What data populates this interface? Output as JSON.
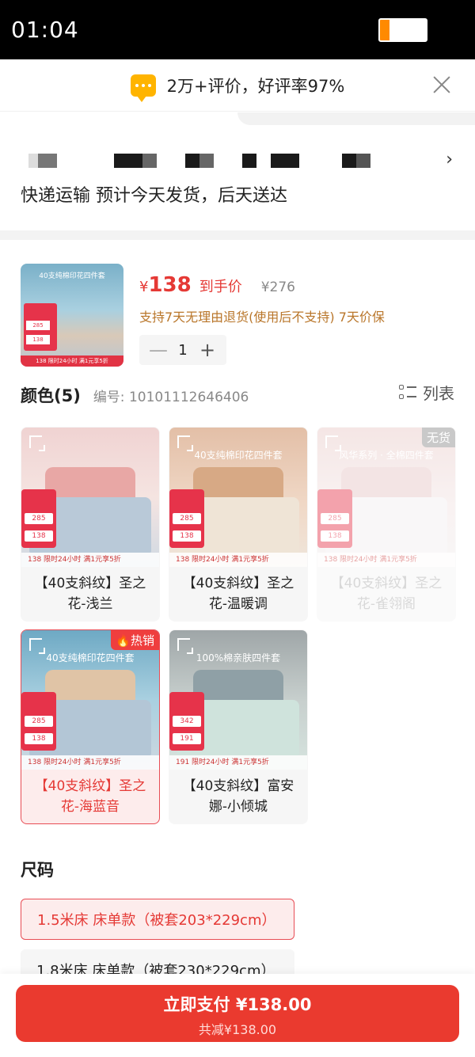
{
  "status_bar": {
    "time": "01:04",
    "battery_level": 0.2
  },
  "rating": {
    "text": "2万+评价，好评率97%"
  },
  "address": {
    "shipping_text": "快递运输 预计今天发货，后天送达",
    "arrow": "›"
  },
  "product": {
    "currency": "¥",
    "price": "138",
    "price_tag": "到手价",
    "original_price": "¥276",
    "policy": "支持7天无理由退货(使用后不支持) 7天价保",
    "quantity": "1",
    "minus": "—",
    "plus": "+",
    "thumb_title": "40支纯棉印花四件套",
    "thumb_price_a": "285",
    "thumb_price_b": "138",
    "thumb_bar": "138  限时24小时 满1元享5折"
  },
  "color_section": {
    "title": "颜色(5)",
    "code_label": "编号: 10101112646406",
    "list_label": "列表"
  },
  "colors": [
    {
      "caption": "【40支斜纹】圣之花-浅兰",
      "img_text": "",
      "price_a": "285",
      "price_b": "138",
      "strip": "138  限时24小时 满1元享5折",
      "bg": "linear-gradient(180deg,#f0d3d2 0%,#f5e4e1 50%,#cfd9e3 100%)",
      "bed": "#b9c9d8",
      "head": "#e8a7a5"
    },
    {
      "caption": "【40支斜纹】圣之花-温暖调",
      "img_text": "40支纯棉印花四件套",
      "price_a": "285",
      "price_b": "138",
      "strip": "138  限时24小时 满1元享5折",
      "bg": "linear-gradient(180deg,#e3bfa7 0%,#f0d8c6 55%,#efe6dc 100%)",
      "bed": "#efe4d6",
      "head": "#d7a985"
    },
    {
      "caption": "【40支斜纹】圣之花-雀翎阁",
      "img_text": "风华系列 · 全棉四件套",
      "price_a": "285",
      "price_b": "138",
      "strip": "138  限时24小时 满1元享5折",
      "badge": "无货",
      "bg": "linear-gradient(180deg,#e9c9c6 0%,#f2e3e3 55%,#f1ecec 100%)",
      "bed": "#f3eef0",
      "head": "#e6c4c4"
    },
    {
      "caption": "【40支斜纹】圣之花-海蓝音",
      "img_text": "40支纯棉印花四件套",
      "price_a": "285",
      "price_b": "138",
      "strip": "138  限时24小时 满1元享5折",
      "badge": "🔥热销",
      "bg": "linear-gradient(180deg,#6ea9c4 0%,#a9d0e0 50%,#cfd8e0 100%)",
      "bed": "#b3c6d6",
      "head": "#e0c4a6"
    },
    {
      "caption": "【40支斜纹】富安娜-小倾城",
      "img_text": "100%棉亲肤四件套",
      "price_a": "342",
      "price_b": "191",
      "strip": "191  限时24小时 满1元享5折",
      "bg": "linear-gradient(180deg,#9fa6a8 0%,#c7cfcd 50%,#d6e4df 100%)",
      "bed": "#cfe3dc",
      "head": "#8fa0a6"
    }
  ],
  "size_section": {
    "title": "尺码",
    "options": [
      {
        "label": "1.5米床 床单款（被套203*229cm）"
      },
      {
        "label": "1.8米床 床单款（被套230*229cm）"
      }
    ]
  },
  "pay": {
    "main": "立即支付 ¥138.00",
    "sub": "共减¥138.00"
  },
  "colors_theme": {
    "accent": "#ea3a2f",
    "price": "#e53935",
    "policy": "#b9762a"
  }
}
